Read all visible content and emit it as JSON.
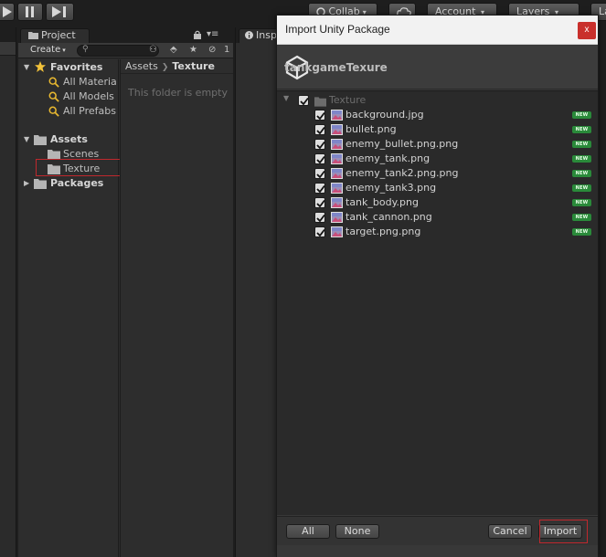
{
  "toolbar": {
    "collab": "Collab",
    "account": "Account",
    "layers": "Layers",
    "layout": "La"
  },
  "project": {
    "tab_label": "Project",
    "create_label": "Create",
    "favorites": {
      "label": "Favorites",
      "items": [
        "All Materia",
        "All Models",
        "All Prefabs"
      ]
    },
    "assets": {
      "label": "Assets",
      "children": [
        "Scenes",
        "Texture"
      ]
    },
    "packages": {
      "label": "Packages"
    },
    "breadcrumb": [
      "Assets",
      "Texture"
    ],
    "empty_message": "This folder is empty",
    "hidden_count": "1"
  },
  "inspector": {
    "tab_label": "Insp"
  },
  "dialog": {
    "title": "Import Unity Package",
    "close_label": "x",
    "package_name": "tankgameTexure",
    "folder": "Texture",
    "new_badge": "NEW",
    "files": [
      "background.jpg",
      "bullet.png",
      "enemy_bullet.png.png",
      "enemy_tank.png",
      "enemy_tank2.png.png",
      "enemy_tank3.png",
      "tank_body.png",
      "tank_cannon.png",
      "target.png.png"
    ],
    "buttons": {
      "all": "All",
      "none": "None",
      "cancel": "Cancel",
      "import": "Import"
    }
  },
  "colors": {
    "highlight_box": "#c0282d",
    "new_badge": "#2a8a3a",
    "close_button": "#c9302c"
  }
}
